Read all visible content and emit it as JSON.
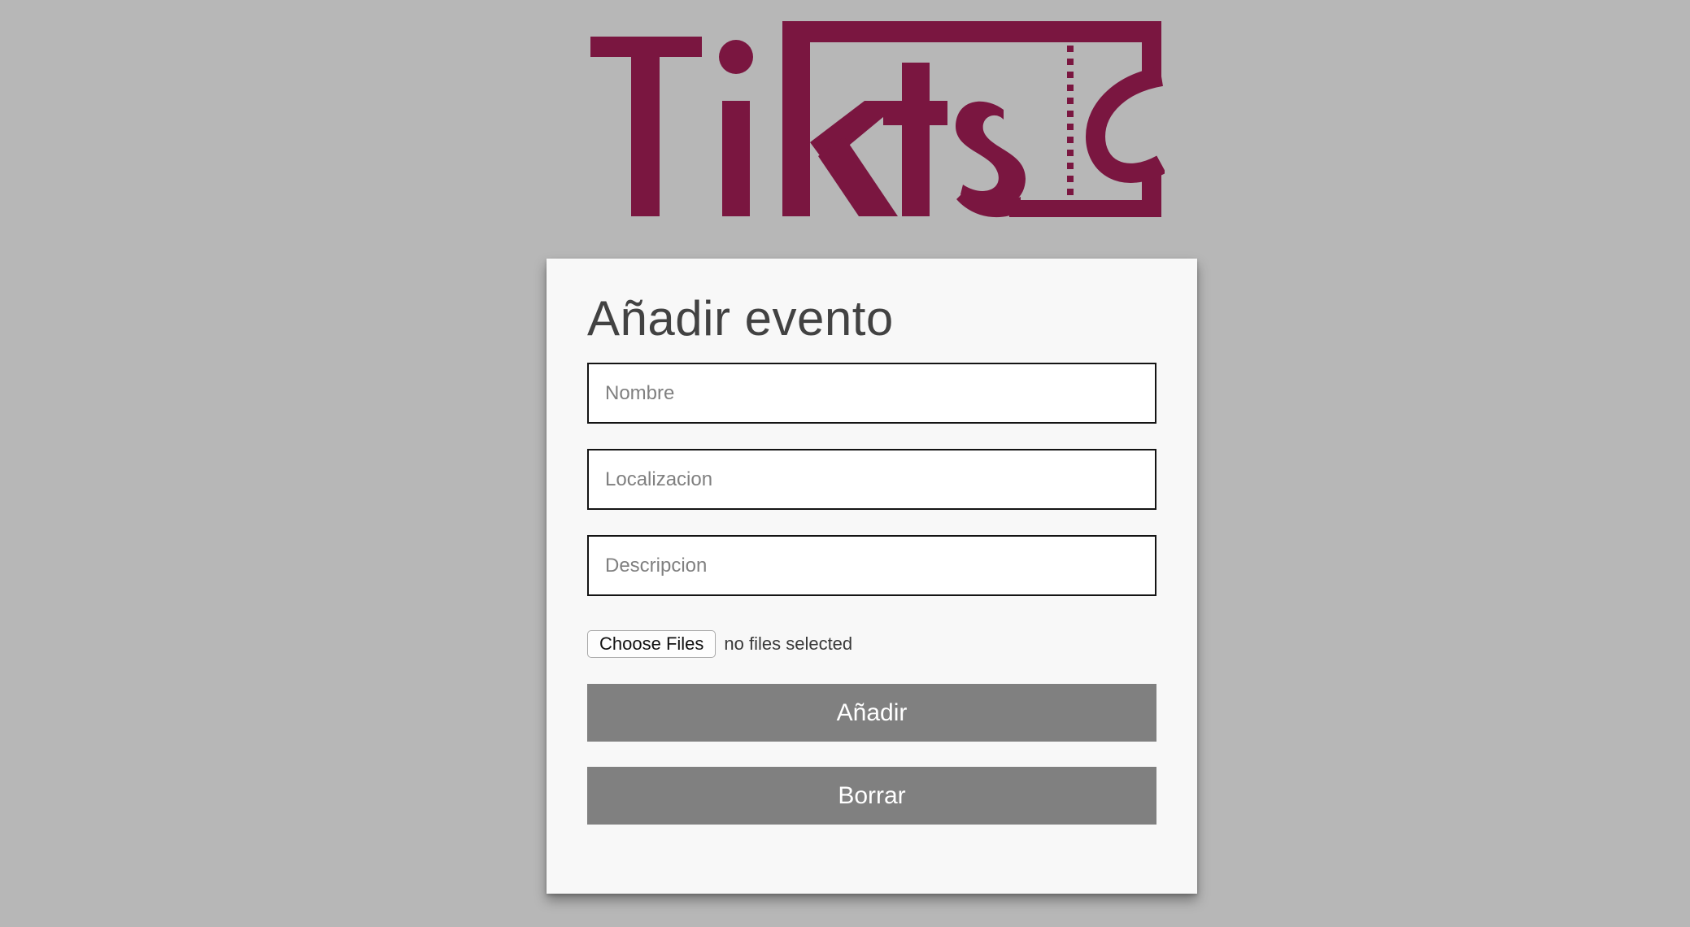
{
  "brand": {
    "name": "Tikts",
    "color": "#7a1640"
  },
  "form": {
    "title": "Añadir evento",
    "nombre_placeholder": "Nombre",
    "localizacion_placeholder": "Localizacion",
    "descripcion_placeholder": "Descripcion",
    "file_button_label": "Choose Files",
    "file_status": "no files selected",
    "submit_label": "Añadir",
    "reset_label": "Borrar"
  },
  "colors": {
    "background": "#b7b7b7",
    "card": "#f8f8f8",
    "button": "#808080"
  }
}
